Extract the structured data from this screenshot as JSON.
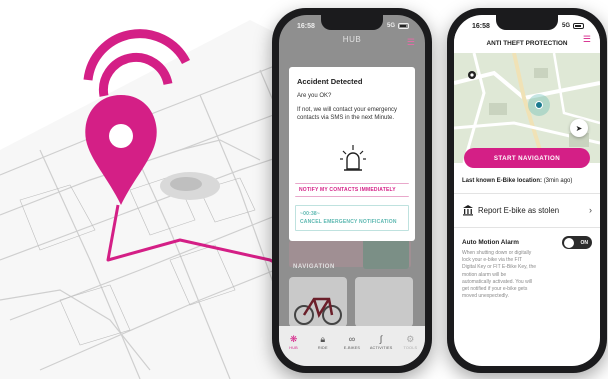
{
  "colors": {
    "accent": "#d41f86",
    "teal": "#5bb7b0",
    "phone_frame": "#1b1b1d"
  },
  "hub_phone": {
    "status_time": "16:58",
    "status_network": "5G",
    "header_title": "HUB",
    "alert": {
      "title": "Accident Detected",
      "question": "Are you OK?",
      "message": "If not, we will contact your emergency contacts via SMS in the next Minute.",
      "notify_label": "NOTIFY MY CONTACTS IMMEDIATELY",
      "countdown": "~00:38~",
      "cancel_label": "CANCEL EMERGENCY NOTIFICATION"
    },
    "section_label": "NAVIGATION",
    "tabs": [
      {
        "label": "HUB",
        "icon": "hub-icon",
        "active": true
      },
      {
        "label": "RIDE",
        "icon": "lock-icon",
        "active": false
      },
      {
        "label": "E-BIKES",
        "icon": "bike-icon",
        "active": false
      },
      {
        "label": "ACTIVITIES",
        "icon": "route-icon",
        "active": false
      },
      {
        "label": "TOOLS",
        "icon": "tools-icon",
        "active": false
      }
    ]
  },
  "antitheft_phone": {
    "status_time": "16:58",
    "status_network": "5G",
    "header_title": "ANTI THEFT PROTECTION",
    "start_navigation_label": "START NAVIGATION",
    "last_known_label": "Last known E-Bike location:",
    "last_known_value": "(3min ago)",
    "report_label": "Report E-bike as stolen",
    "motion_alarm_title": "Auto Motion Alarm",
    "motion_alarm_state": "ON",
    "motion_alarm_desc": "When shutting down or digitally lock your e-bike via the FIT Digital Key or FIT E-Bike Key, the motion alarm will be automatically activated. You will get notified if your e-bike gets moved unexpectedly."
  }
}
